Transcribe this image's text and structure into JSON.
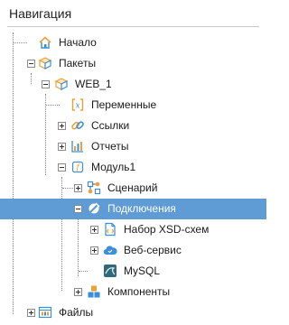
{
  "panel": {
    "title": "Навигация"
  },
  "tree": {
    "start": "Начало",
    "packages": "Пакеты",
    "web1": "WEB_1",
    "variables": "Переменные",
    "links": "Ссылки",
    "reports": "Отчеты",
    "module1": "Модуль1",
    "scenario": "Сценарий",
    "connections": "Подключения",
    "xsd": "Набор XSD-схем",
    "webservice": "Веб-сервис",
    "mysql": "MySQL",
    "components": "Компоненты",
    "files": "Файлы"
  },
  "selected_item": "Подключения",
  "colors": {
    "selection": "#5f9bd4",
    "accent_orange": "#f0a030",
    "accent_blue": "#3a8fd8"
  }
}
